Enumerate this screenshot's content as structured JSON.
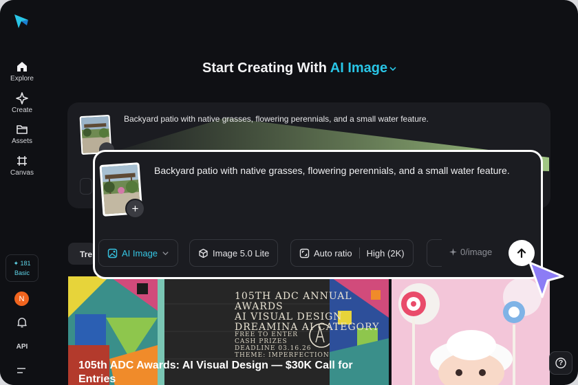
{
  "sidebar": {
    "items": [
      {
        "label": "Explore",
        "icon": "home-icon"
      },
      {
        "label": "Create",
        "icon": "sparkle-icon"
      },
      {
        "label": "Assets",
        "icon": "folder-icon"
      },
      {
        "label": "Canvas",
        "icon": "canvas-icon"
      }
    ],
    "credits": {
      "amount": "✦ 181",
      "plan": "Basic"
    },
    "avatar_initial": "N",
    "api_label": "API"
  },
  "heading": {
    "prefix": "Start Creating With ",
    "mode": "AI Image"
  },
  "background_card": {
    "prompt": "Backyard patio with native grasses, flowering perennials, and a small water feature."
  },
  "trending_tab_partial": "Tre",
  "prompt_card": {
    "prompt": "Backyard patio with native grasses, flowering perennials, and a small water feature.",
    "toolbar": {
      "mode_label": "AI Image",
      "model_label": "Image 5.0 Lite",
      "ratio_label": "Auto ratio",
      "quality_label": "High (2K)",
      "cost_label": "0/image"
    }
  },
  "gallery": {
    "card1": {
      "poster_lines": [
        "105TH ADC ANNUAL AWARDS",
        "AI VISUAL DESIGN",
        "DREAMINA AI CATEGORY"
      ],
      "poster_details": [
        "FREE TO ENTER",
        "CASH PRIZES",
        "DEADLINE 03.16.26",
        "THEME: IMPERFECTION"
      ],
      "title": "105th ADC Awards: AI Visual Design — $30K Call for Entries"
    }
  },
  "help_label": "?",
  "colors": {
    "accent": "#29c5e6",
    "background": "#0f1014",
    "card": "#1b1c21"
  }
}
